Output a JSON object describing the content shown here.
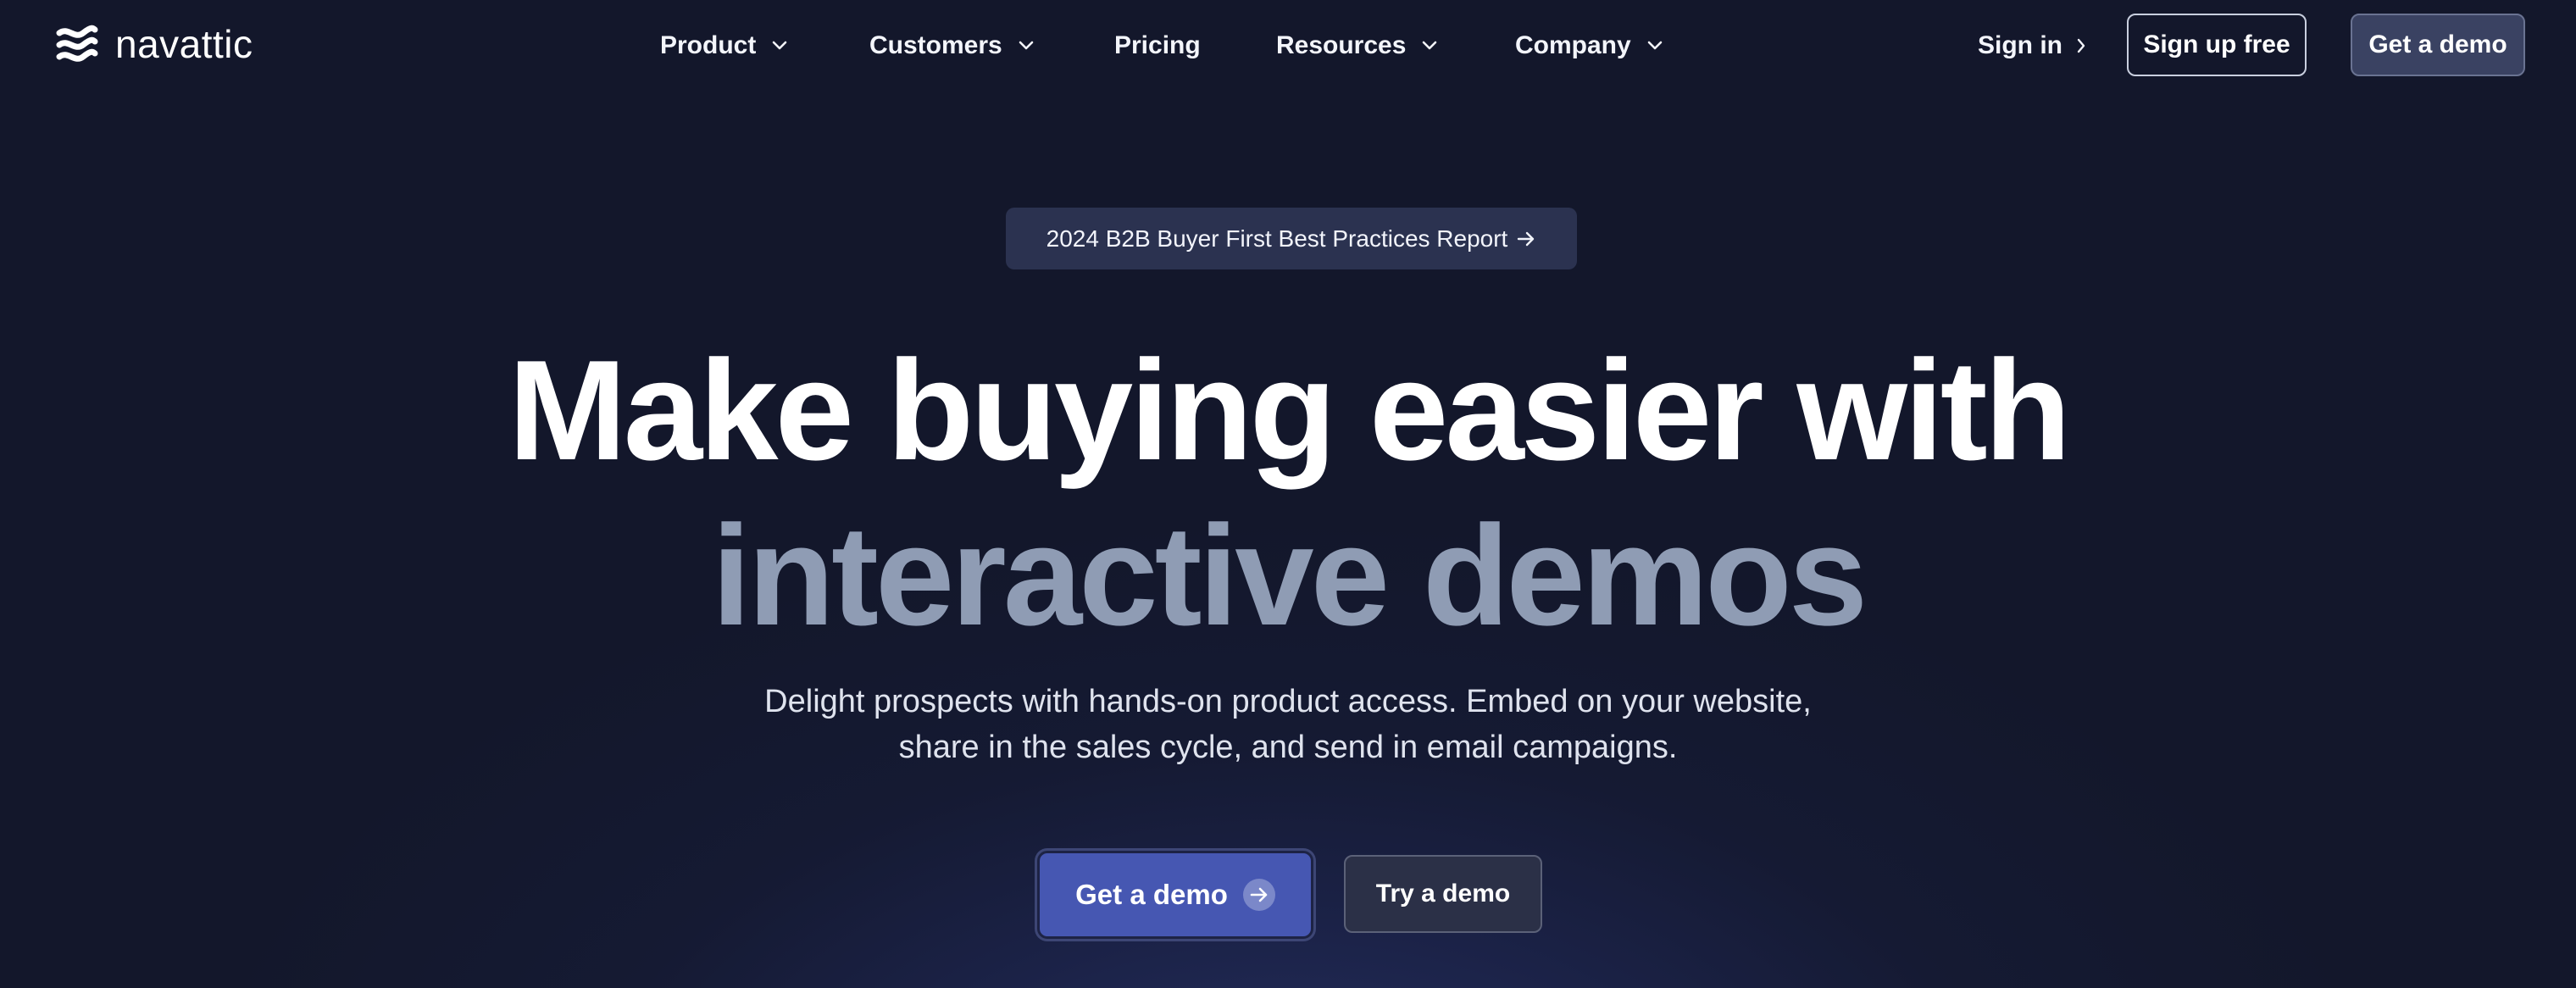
{
  "brand": {
    "name": "navattic",
    "logo_icon": "navattic-wave-logo"
  },
  "nav": {
    "menu": [
      {
        "label": "Product",
        "has_dropdown": true
      },
      {
        "label": "Customers",
        "has_dropdown": true
      },
      {
        "label": "Pricing",
        "has_dropdown": false
      },
      {
        "label": "Resources",
        "has_dropdown": true
      },
      {
        "label": "Company",
        "has_dropdown": true
      }
    ],
    "sign_in": "Sign in",
    "sign_up": "Sign up free",
    "get_demo": "Get a demo"
  },
  "hero": {
    "announcement": "2024 B2B Buyer First Best Practices Report",
    "headline_line1": "Make buying easier with",
    "headline_line2": "interactive demos",
    "subtitle": "Delight prospects with hands-on product access. Embed on your website, share in the sales cycle, and send in email campaigns.",
    "cta_primary": "Get a demo",
    "cta_secondary": "Try a demo"
  },
  "colors": {
    "background": "#151a33",
    "primary_button": "#4657b2",
    "headline_muted": "#8f9cb4",
    "text": "#ffffff"
  }
}
